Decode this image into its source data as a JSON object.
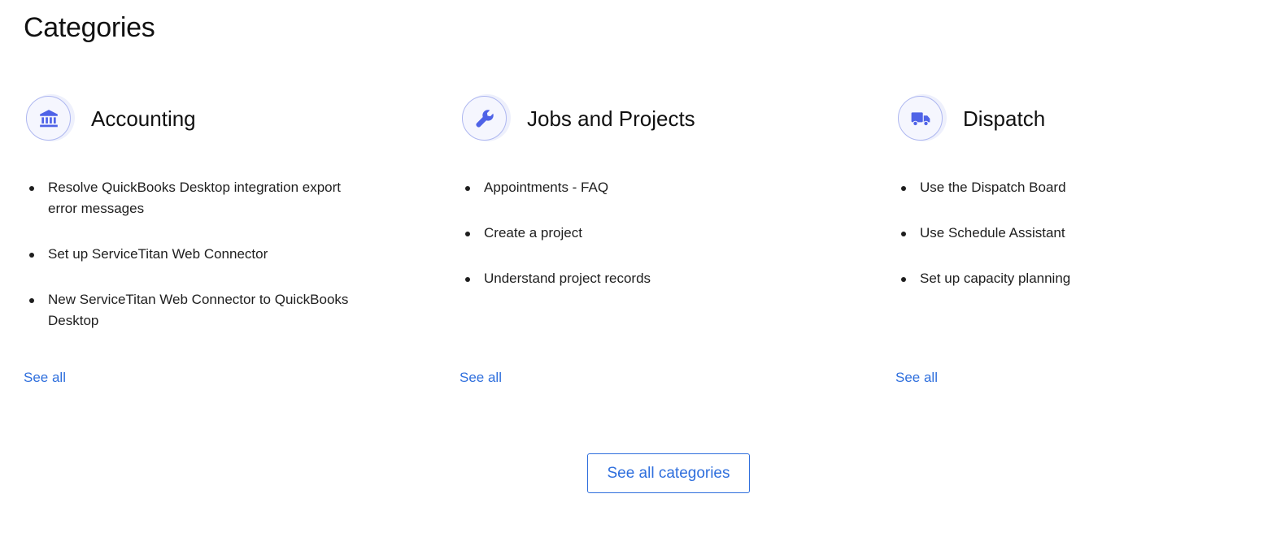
{
  "page_title": "Categories",
  "accent_color": "#2f6fdd",
  "icon_color": "#4f63e7",
  "categories": [
    {
      "title": "Accounting",
      "icon": "bank-icon",
      "articles": [
        "Resolve QuickBooks Desktop integration export error messages",
        "Set up ServiceTitan Web Connector",
        "New ServiceTitan Web Connector to QuickBooks Desktop"
      ],
      "see_all_label": "See all"
    },
    {
      "title": "Jobs and Projects",
      "icon": "wrench-icon",
      "articles": [
        "Appointments - FAQ",
        "Create a project",
        "Understand project records"
      ],
      "see_all_label": "See all"
    },
    {
      "title": "Dispatch",
      "icon": "truck-icon",
      "articles": [
        "Use the Dispatch Board",
        "Use Schedule Assistant",
        "Set up capacity planning"
      ],
      "see_all_label": "See all"
    }
  ],
  "see_all_categories_label": "See all categories"
}
